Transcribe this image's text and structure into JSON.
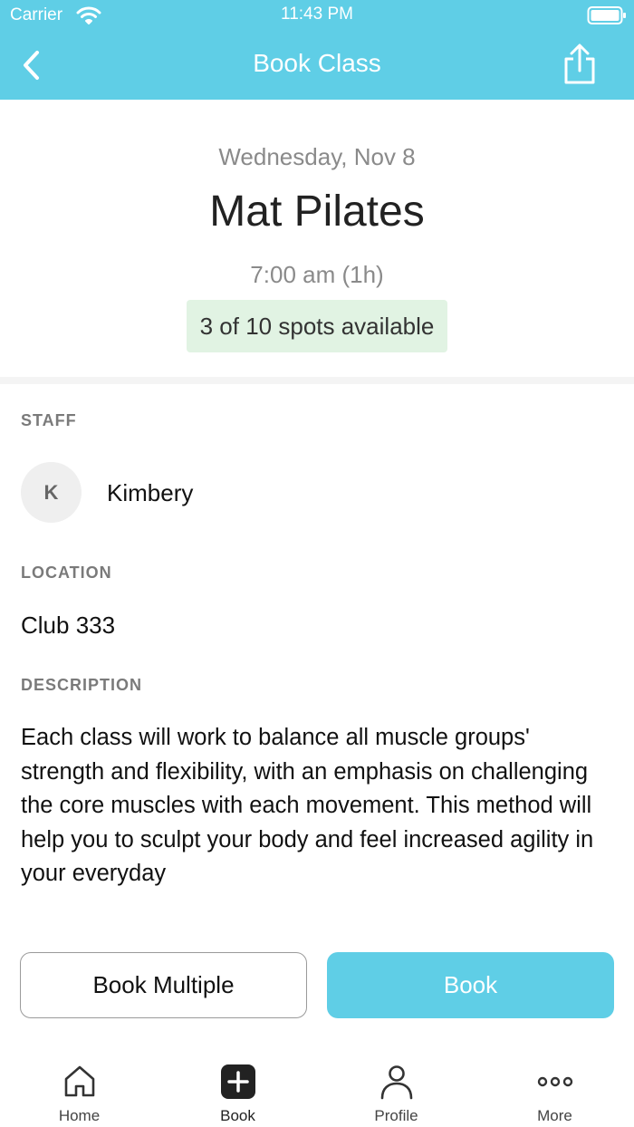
{
  "status_bar": {
    "carrier": "Carrier",
    "time": "11:43 PM"
  },
  "nav": {
    "title": "Book Class",
    "back_icon": "chevron-left-icon",
    "share_icon": "share-icon"
  },
  "class": {
    "date": "Wednesday, Nov 8",
    "name": "Mat Pilates",
    "time": "7:00 am (1h)",
    "spots": "3 of 10 spots available"
  },
  "staff": {
    "label": "STAFF",
    "initial": "K",
    "name": "Kimbery"
  },
  "location": {
    "label": "LOCATION",
    "value": "Club 333"
  },
  "description": {
    "label": "DESCRIPTION",
    "text": "Each class will work to balance all muscle groups' strength and flexibility, with an emphasis on challenging the core muscles with each movement. This method will help you to sculpt your body and feel increased agility in your everyday"
  },
  "actions": {
    "book_multiple": "Book Multiple",
    "book": "Book"
  },
  "tabs": [
    {
      "label": "Home",
      "icon": "home-icon"
    },
    {
      "label": "Book",
      "icon": "plus-square-icon"
    },
    {
      "label": "Profile",
      "icon": "person-icon"
    },
    {
      "label": "More",
      "icon": "more-dots-icon"
    }
  ],
  "colors": {
    "accent": "#5fcee6",
    "badge_bg": "#e1f3e3"
  }
}
